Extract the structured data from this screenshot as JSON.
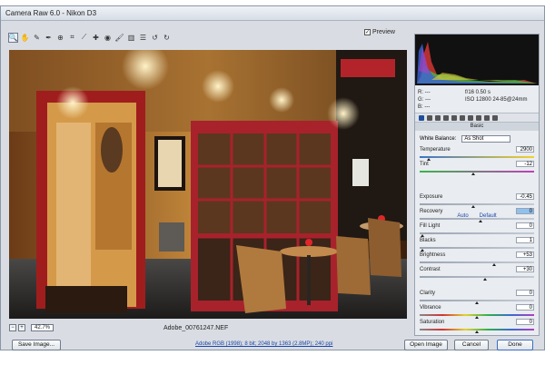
{
  "window": {
    "title": "Camera Raw 6.0  -  Nikon D3"
  },
  "toolbar": {
    "tools": [
      "zoom-icon",
      "hand-icon",
      "white-balance-icon",
      "color-sampler-icon",
      "target-adjust-icon",
      "crop-icon",
      "straighten-icon",
      "spot-removal-icon",
      "red-eye-icon",
      "adjustment-brush-icon",
      "graduated-filter-icon",
      "preferences-icon",
      "rotate-ccw-icon",
      "rotate-cw-icon"
    ],
    "preview_label": "Preview",
    "preview_checked": true
  },
  "image": {
    "filename": "Adobe_00761247.NEF",
    "zoom": "42.7%"
  },
  "stats": {
    "r": "R:   ---",
    "g": "G:   ---",
    "b": "B:   ---",
    "aperture_shutter": "f/16    0.50 s",
    "iso_lens": "ISO 12800   24-85@24mm"
  },
  "panel": {
    "title": "Basic",
    "white_balance_label": "White Balance:",
    "white_balance_value": "As Shot",
    "auto": "Auto",
    "default": "Default",
    "sliders": [
      {
        "name": "Temperature",
        "value": "2900",
        "pos": 0.08
      },
      {
        "name": "Tint",
        "value": "-12",
        "pos": 0.47
      },
      {
        "name": "Exposure",
        "value": "-0.45",
        "pos": 0.47
      },
      {
        "name": "Recovery",
        "value": "0",
        "pos": 0.53
      },
      {
        "name": "Fill Light",
        "value": "0",
        "pos": 0.02
      },
      {
        "name": "Blacks",
        "value": "1",
        "pos": 0.02
      },
      {
        "name": "Brightness",
        "value": "+53",
        "pos": 0.65
      },
      {
        "name": "Contrast",
        "value": "+30",
        "pos": 0.57
      },
      {
        "name": "Clarity",
        "value": "0",
        "pos": 0.5
      },
      {
        "name": "Vibrance",
        "value": "0",
        "pos": 0.5
      },
      {
        "name": "Saturation",
        "value": "0",
        "pos": 0.5
      }
    ]
  },
  "footer": {
    "save": "Save Image...",
    "workflow": "Adobe RGB (1998); 8 bit; 2048 by 1363 (2.8MP); 240 ppi",
    "open": "Open Image",
    "cancel": "Cancel",
    "done": "Done"
  }
}
